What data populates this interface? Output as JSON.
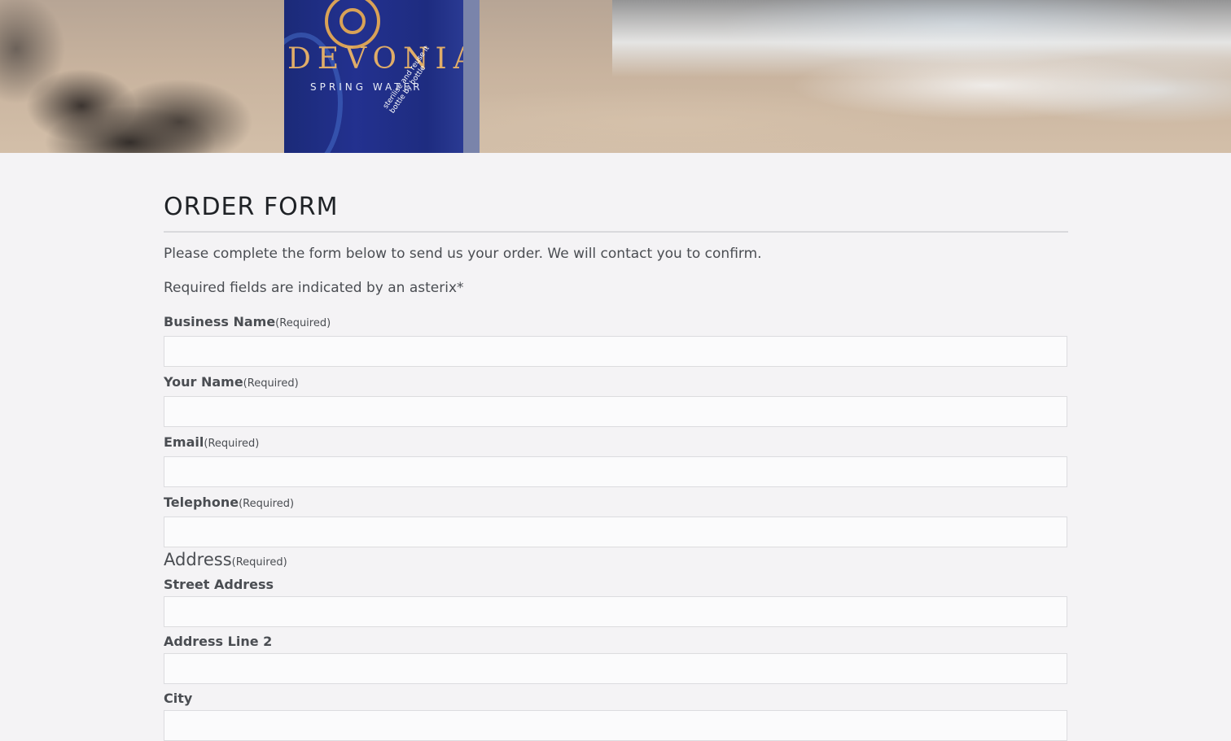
{
  "hero": {
    "brand": "DEVONIA",
    "subtitle": "SPRING WATER",
    "slogan": "sterilise and reuse it bottle by bottle"
  },
  "form": {
    "title": "ORDER FORM",
    "intro": "Please complete the form below to send us your order. We will contact you to confirm.",
    "required_note": "Required fields are indicated by an asterix*",
    "required_tag": "(Required)",
    "fields": {
      "business_name": {
        "label": "Business Name",
        "value": ""
      },
      "your_name": {
        "label": "Your Name",
        "value": ""
      },
      "email": {
        "label": "Email",
        "value": ""
      },
      "telephone": {
        "label": "Telephone",
        "value": ""
      }
    },
    "address": {
      "legend": "Address",
      "street": {
        "label": "Street Address",
        "value": ""
      },
      "line2": {
        "label": "Address Line 2",
        "value": ""
      },
      "city": {
        "label": "City",
        "value": ""
      }
    }
  }
}
